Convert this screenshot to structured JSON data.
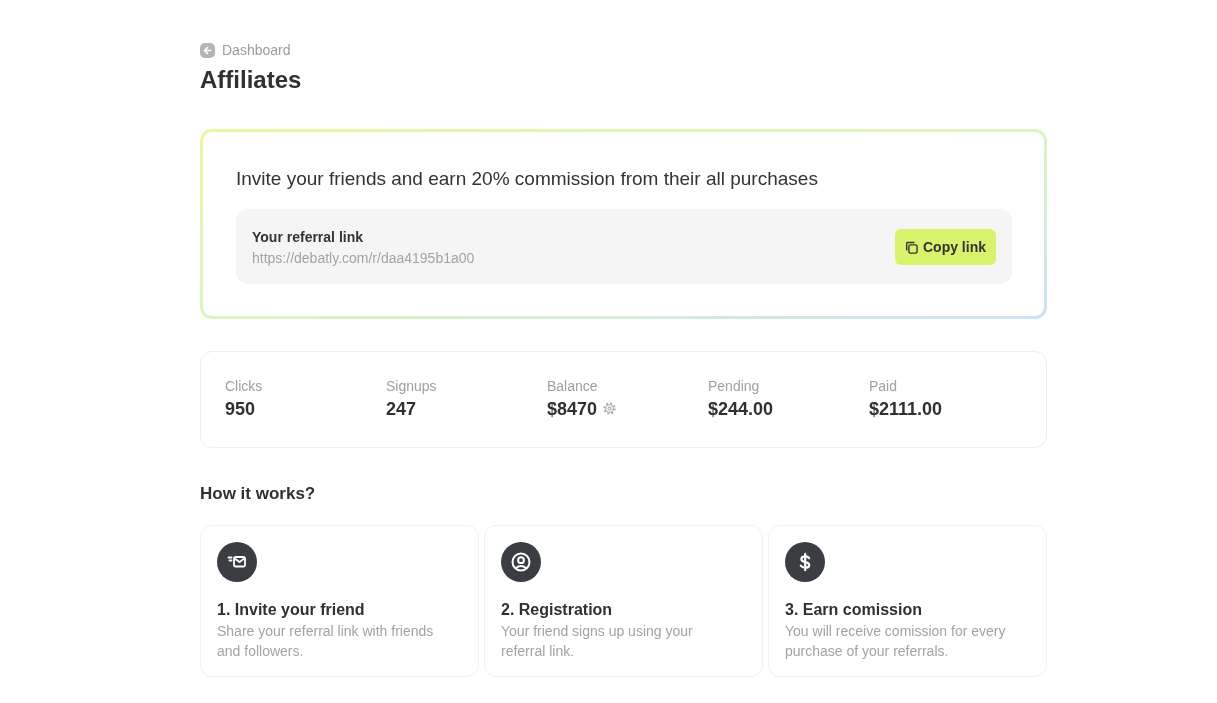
{
  "breadcrumb": {
    "label": "Dashboard"
  },
  "page_title": "Affiliates",
  "invite_card": {
    "heading": "Invite your friends and earn 20% commission from their all purchases",
    "referral": {
      "label": "Your referral link",
      "url": "https://debatly.com/r/daa4195b1a00"
    },
    "copy_button": "Copy link"
  },
  "stats": [
    {
      "label": "Clicks",
      "value": "950",
      "settings_icon": false
    },
    {
      "label": "Signups",
      "value": "247",
      "settings_icon": false
    },
    {
      "label": "Balance",
      "value": "$8470",
      "settings_icon": true
    },
    {
      "label": "Pending",
      "value": "$244.00",
      "settings_icon": false
    },
    {
      "label": "Paid",
      "value": "$2111.00",
      "settings_icon": false
    }
  ],
  "how_it_works": {
    "title": "How it works?",
    "steps": [
      {
        "kind": "mail",
        "title": "1. Invite your friend",
        "description": "Share your referral link with friends and followers."
      },
      {
        "kind": "user",
        "title": "2. Registration",
        "description": "Your friend signs up using your referral link."
      },
      {
        "kind": "dollar",
        "title": "3. Earn comission",
        "description": "You will receive comission for every purchase of your referrals."
      }
    ]
  }
}
